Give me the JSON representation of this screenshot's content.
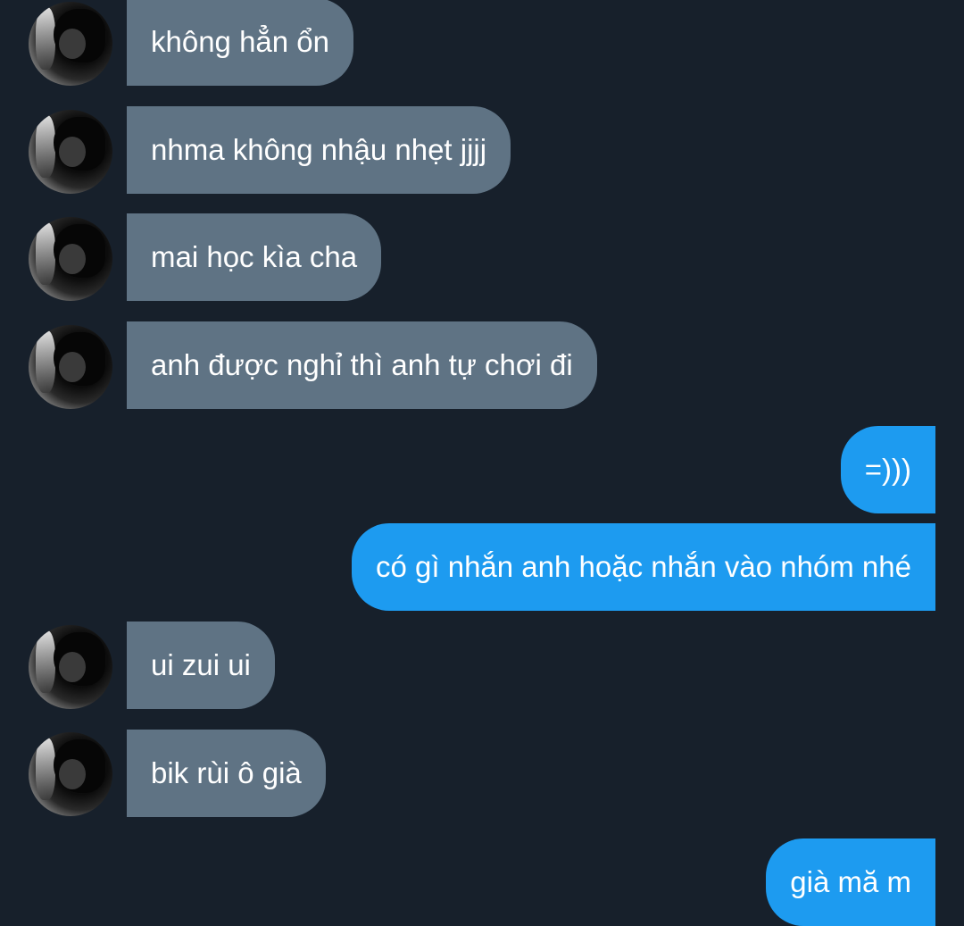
{
  "messages": [
    {
      "direction": "incoming",
      "text": "không hẳn ổn"
    },
    {
      "direction": "incoming",
      "text": "nhma không nhậu nhẹt jjjj"
    },
    {
      "direction": "incoming",
      "text": "mai học kìa cha"
    },
    {
      "direction": "incoming",
      "text": "anh được nghỉ thì anh tự chơi đi"
    },
    {
      "direction": "outgoing",
      "text": "=)))"
    },
    {
      "direction": "outgoing",
      "text": "có gì nhắn anh hoặc nhắn vào nhóm nhé"
    },
    {
      "direction": "incoming",
      "text": "ui zui ui"
    },
    {
      "direction": "incoming",
      "text": "bik rùi ô già"
    },
    {
      "direction": "outgoing",
      "text": "già mă m"
    }
  ],
  "colors": {
    "background": "#17202b",
    "incoming_bubble": "#5f7384",
    "outgoing_bubble": "#1d9bf0",
    "text": "#ffffff"
  }
}
